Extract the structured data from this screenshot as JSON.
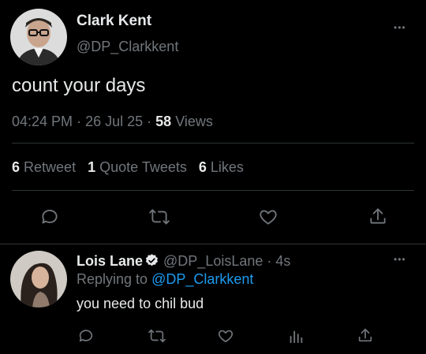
{
  "tweet": {
    "author_name": "Clark Kent",
    "author_handle": "@DP_Clarkkent",
    "text": "count your days",
    "time": "04:24 PM",
    "sep1": "·",
    "date": "26 Jul 25",
    "sep2": "·",
    "views_count": "58",
    "views_label": "Views",
    "more_label": "•••"
  },
  "stats": {
    "retweets_count": "6",
    "retweets_label": "Retweet",
    "quotes_count": "1",
    "quotes_label": "Quote Tweets",
    "likes_count": "6",
    "likes_label": "Likes"
  },
  "reply": {
    "author_name": "Lois Lane",
    "author_handle": "@DP_LoisLane",
    "sep": "·",
    "time_ago": "4s",
    "replying_prefix": "Replying to",
    "replying_handle": "@DP_Clarkkent",
    "text": "you need to chil bud",
    "more_label": "•••"
  },
  "icons": [
    "reply-icon",
    "retweet-icon",
    "like-icon",
    "share-icon",
    "verified-badge-icon",
    "views-icon"
  ],
  "colors": {
    "background": "#000000",
    "text": "#e7e9ea",
    "muted": "#71767b",
    "link": "#1d9bf0",
    "divider": "#2f3336"
  }
}
